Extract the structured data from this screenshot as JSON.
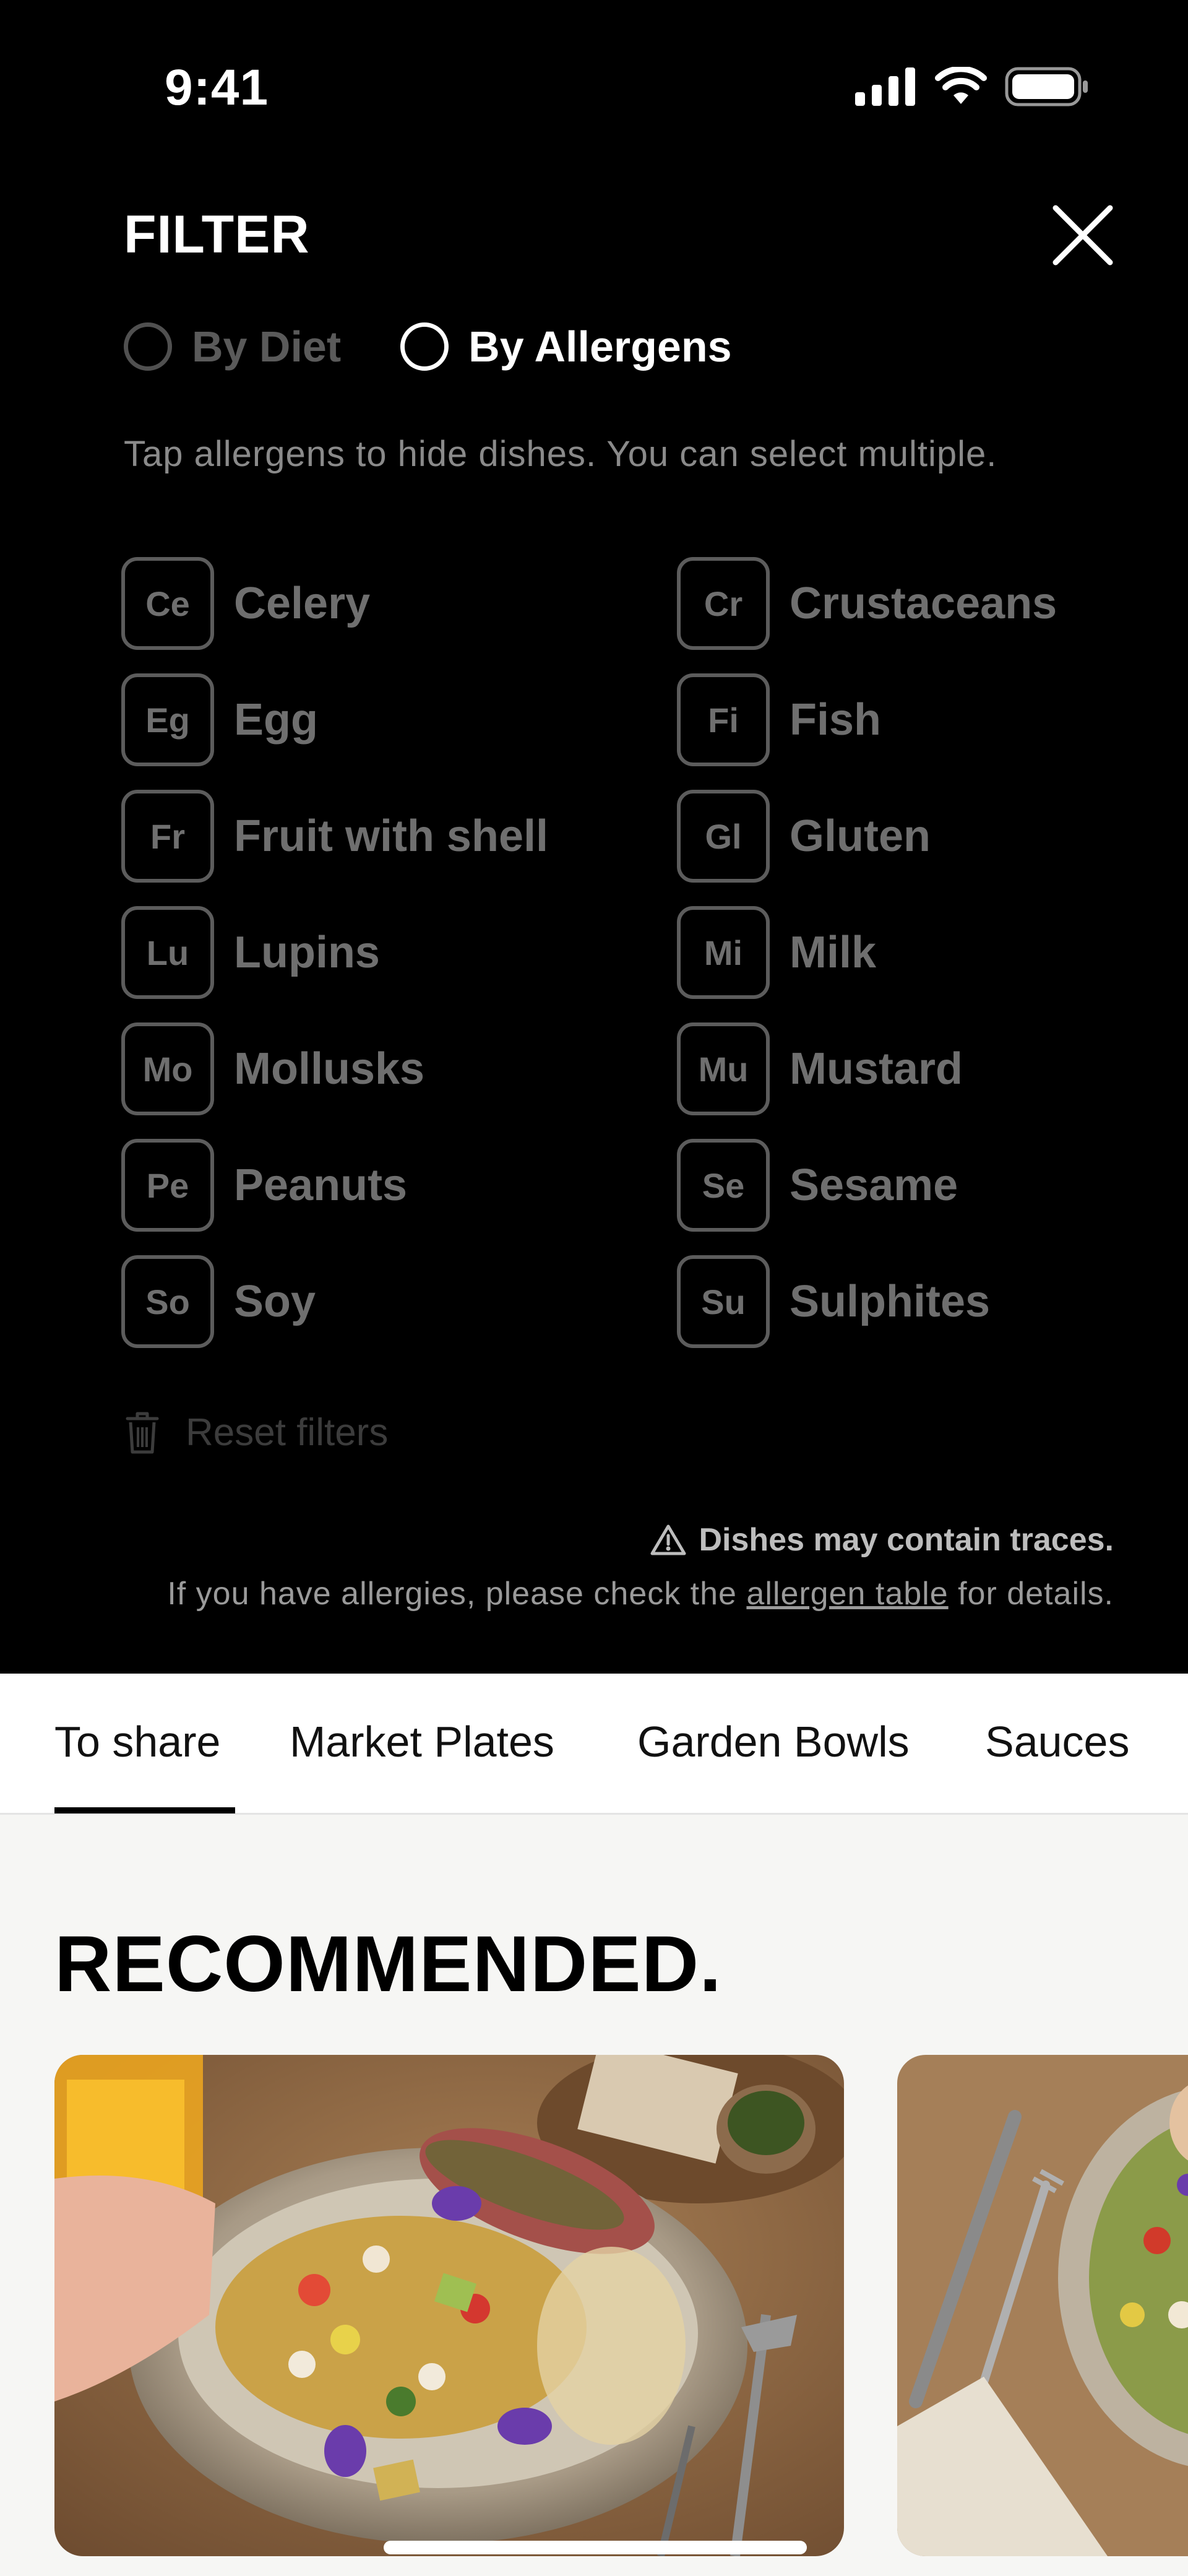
{
  "status_bar": {
    "time": "9:41"
  },
  "filter": {
    "title": "FILTER",
    "modes": [
      {
        "label": "By Diet",
        "selected": false
      },
      {
        "label": "By Allergens",
        "selected": true
      }
    ],
    "hint": "Tap allergens to hide dishes. You can select multiple.",
    "allergens": [
      {
        "code": "Ce",
        "name": "Celery"
      },
      {
        "code": "Cr",
        "name": "Crustaceans"
      },
      {
        "code": "Eg",
        "name": "Egg"
      },
      {
        "code": "Fi",
        "name": "Fish"
      },
      {
        "code": "Fr",
        "name": "Fruit with shell"
      },
      {
        "code": "Gl",
        "name": "Gluten"
      },
      {
        "code": "Lu",
        "name": "Lupins"
      },
      {
        "code": "Mi",
        "name": "Milk"
      },
      {
        "code": "Mo",
        "name": "Mollusks"
      },
      {
        "code": "Mu",
        "name": "Mustard"
      },
      {
        "code": "Pe",
        "name": "Peanuts"
      },
      {
        "code": "Se",
        "name": "Sesame"
      },
      {
        "code": "So",
        "name": "Soy"
      },
      {
        "code": "Su",
        "name": "Sulphites"
      }
    ],
    "reset_label": "Reset filters",
    "traces_warning": "Dishes may contain traces.",
    "disclaimer_prefix": "If you have allergies, please check the ",
    "disclaimer_link": "allergen table",
    "disclaimer_suffix": " for details."
  },
  "tabs": {
    "items": [
      "To share",
      "Market Plates",
      "Garden Bowls",
      "Sauces"
    ],
    "active_index": 0
  },
  "section": {
    "title": "RECOMMENDED."
  },
  "colors": {
    "panel_bg": "#000000",
    "page_bg": "#f6f6f4",
    "muted": "#6f6f6f"
  }
}
